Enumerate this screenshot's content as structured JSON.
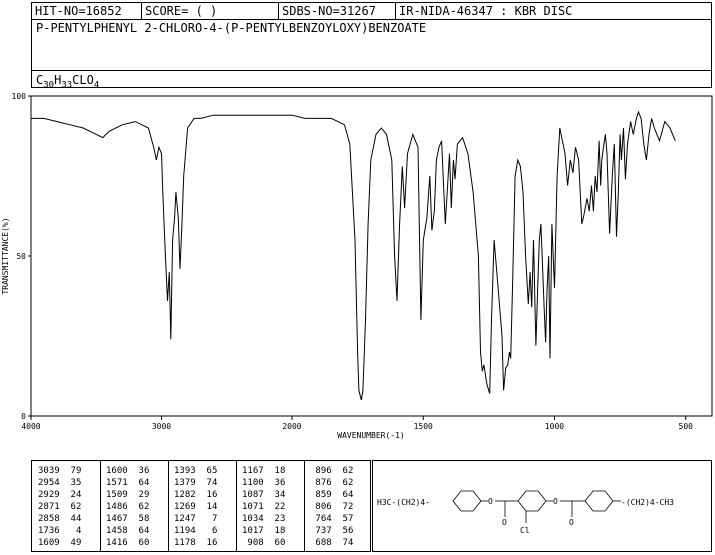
{
  "header": {
    "hit_no": "HIT-NO=16852",
    "score": "SCORE=  (   )",
    "sdbs_no": "SDBS-NO=31267",
    "ir_info": "IR-NIDA-46347 : KBR DISC",
    "compound_name": "P-PENTYLPHENYL 2-CHLORO-4-(P-PENTYLBENZOYLOXY)BENZOATE",
    "formula_parts": [
      "C",
      "30",
      "H",
      "33",
      "CLO",
      "4"
    ]
  },
  "chart_data": {
    "type": "line",
    "xlabel": "WAVENUMBER(-1)",
    "ylabel": "TRANSMITTANCE(%)",
    "xlim": [
      4000,
      400
    ],
    "ylim": [
      0,
      100
    ],
    "xticks": [
      4000,
      3000,
      2000,
      1500,
      1000,
      500
    ],
    "yticks": [
      0,
      50,
      100
    ],
    "x": [
      4000,
      3900,
      3800,
      3700,
      3600,
      3500,
      3450,
      3400,
      3300,
      3200,
      3100,
      3060,
      3039,
      3020,
      3000,
      2990,
      2970,
      2954,
      2940,
      2929,
      2915,
      2900,
      2890,
      2871,
      2858,
      2845,
      2830,
      2800,
      2750,
      2700,
      2600,
      2500,
      2400,
      2300,
      2200,
      2100,
      2000,
      1950,
      1900,
      1850,
      1800,
      1780,
      1760,
      1750,
      1745,
      1736,
      1730,
      1720,
      1710,
      1700,
      1680,
      1660,
      1640,
      1620,
      1609,
      1600,
      1590,
      1580,
      1571,
      1560,
      1540,
      1520,
      1509,
      1500,
      1486,
      1475,
      1467,
      1458,
      1450,
      1440,
      1430,
      1416,
      1400,
      1393,
      1385,
      1379,
      1370,
      1350,
      1330,
      1310,
      1290,
      1282,
      1275,
      1269,
      1258,
      1247,
      1240,
      1230,
      1220,
      1210,
      1200,
      1194,
      1186,
      1178,
      1172,
      1167,
      1160,
      1150,
      1140,
      1130,
      1120,
      1110,
      1100,
      1093,
      1087,
      1080,
      1071,
      1064,
      1058,
      1052,
      1046,
      1040,
      1034,
      1028,
      1022,
      1017,
      1010,
      1000,
      990,
      980,
      970,
      960,
      950,
      940,
      930,
      920,
      908,
      896,
      890,
      876,
      868,
      859,
      852,
      845,
      838,
      830,
      824,
      820,
      812,
      806,
      800,
      790,
      780,
      772,
      764,
      757,
      750,
      745,
      737,
      730,
      722,
      710,
      700,
      688,
      680,
      670,
      660,
      650,
      640,
      630,
      620,
      600,
      580,
      560,
      540,
      520,
      500,
      480,
      460,
      440,
      420,
      400
    ],
    "y": [
      93,
      93,
      92,
      91,
      90,
      88,
      87,
      89,
      91,
      92,
      90,
      84,
      80,
      84,
      82,
      70,
      50,
      36,
      45,
      24,
      55,
      62,
      70,
      62,
      46,
      58,
      75,
      90,
      93,
      93,
      94,
      94,
      94,
      94,
      94,
      94,
      94,
      93,
      93,
      93,
      91,
      85,
      55,
      20,
      8,
      5,
      8,
      30,
      60,
      80,
      88,
      90,
      88,
      80,
      50,
      36,
      60,
      78,
      65,
      82,
      88,
      84,
      30,
      55,
      62,
      75,
      58,
      64,
      80,
      84,
      86,
      60,
      82,
      65,
      80,
      74,
      85,
      87,
      82,
      70,
      50,
      20,
      14,
      16,
      10,
      7,
      30,
      55,
      45,
      35,
      25,
      8,
      15,
      16,
      20,
      18,
      40,
      75,
      80,
      78,
      70,
      50,
      35,
      45,
      34,
      55,
      22,
      40,
      55,
      60,
      48,
      35,
      23,
      40,
      50,
      18,
      60,
      40,
      75,
      90,
      86,
      82,
      72,
      80,
      76,
      84,
      80,
      60,
      62,
      68,
      64,
      72,
      64,
      75,
      70,
      86,
      72,
      80,
      85,
      88,
      82,
      57,
      75,
      85,
      56,
      70,
      88,
      80,
      90,
      74,
      85,
      92,
      88,
      93,
      95,
      93,
      85,
      80,
      88,
      93,
      90,
      86,
      92,
      90,
      86
    ],
    "grid": false
  },
  "peaks": {
    "columns": [
      [
        [
          "3039",
          "79"
        ],
        [
          "2954",
          "35"
        ],
        [
          "2929",
          "24"
        ],
        [
          "2871",
          "62"
        ],
        [
          "2858",
          "44"
        ],
        [
          "1736",
          "4"
        ],
        [
          "1609",
          "49"
        ]
      ],
      [
        [
          "1600",
          "36"
        ],
        [
          "1571",
          "64"
        ],
        [
          "1509",
          "29"
        ],
        [
          "1486",
          "62"
        ],
        [
          "1467",
          "58"
        ],
        [
          "1458",
          "64"
        ],
        [
          "1416",
          "60"
        ]
      ],
      [
        [
          "1393",
          "65"
        ],
        [
          "1379",
          "74"
        ],
        [
          "1282",
          "16"
        ],
        [
          "1269",
          "14"
        ],
        [
          "1247",
          "7"
        ],
        [
          "1194",
          "6"
        ],
        [
          "1178",
          "16"
        ]
      ],
      [
        [
          "1167",
          "18"
        ],
        [
          "1100",
          "36"
        ],
        [
          "1087",
          "34"
        ],
        [
          "1071",
          "22"
        ],
        [
          "1034",
          "23"
        ],
        [
          "1017",
          "18"
        ],
        [
          "908",
          "60"
        ]
      ],
      [
        [
          "896",
          "62"
        ],
        [
          "876",
          "62"
        ],
        [
          "859",
          "64"
        ],
        [
          "806",
          "72"
        ],
        [
          "764",
          "57"
        ],
        [
          "737",
          "56"
        ],
        [
          "688",
          "74"
        ]
      ]
    ]
  },
  "structure": {
    "left_label": "H3C-(CH2)4-",
    "right_label": "-(CH2)4-CH3",
    "cl_label": "Cl",
    "o_label": "O"
  }
}
